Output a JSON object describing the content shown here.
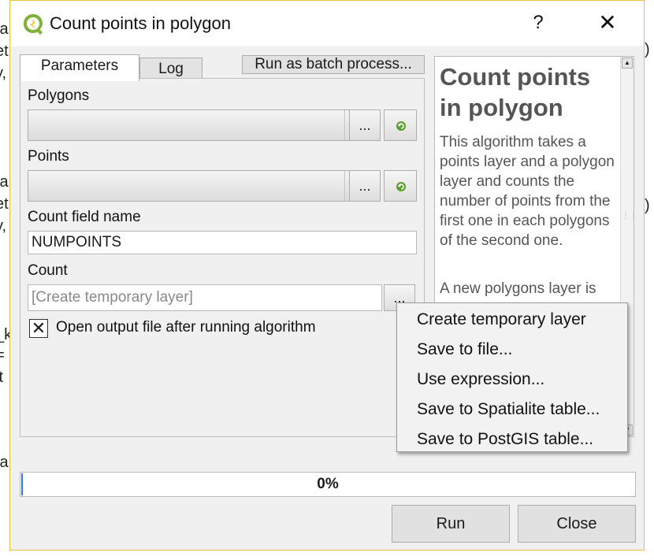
{
  "dialog": {
    "title": "Count points in polygon",
    "help_button": "?",
    "close_button": "✕"
  },
  "tabs": [
    {
      "label": "Parameters",
      "active": true
    },
    {
      "label": "Log",
      "active": false
    }
  ],
  "batch_button": "Run as batch process...",
  "fields": {
    "polygons_label": "Polygons",
    "polygons_value": "",
    "points_label": "Points",
    "points_value": "",
    "browse_label": "...",
    "count_field_label": "Count field name",
    "count_field_value": "NUMPOINTS",
    "count_label": "Count",
    "count_placeholder": "[Create temporary layer]",
    "open_output_label": "Open output file after running algorithm",
    "open_output_checked": true,
    "check_glyph": "✕"
  },
  "help": {
    "title": "Count points in polygon",
    "body": "This algorithm takes a points layer and a polygon layer and counts the number of points from the first one in each polygons of the second one.",
    "body2": "A new polygons layer is"
  },
  "menu": {
    "items": [
      "Create temporary layer",
      "Save to file...",
      "Use expression...",
      "Save to Spatialite table...",
      "Save to PostGIS table..."
    ]
  },
  "progress": {
    "value": 0,
    "label": "0%"
  },
  "buttons": {
    "run": "Run",
    "close": "Close"
  },
  "colors": {
    "accent_border": "#e8c23a",
    "progress_fill": "#2f7ad6"
  }
}
